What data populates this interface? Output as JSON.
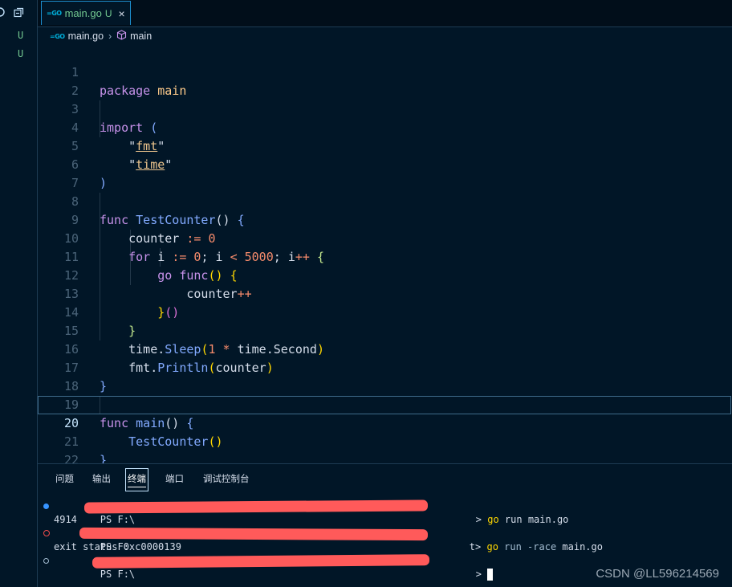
{
  "sidebar": {
    "control_icons": [
      "refresh-icon",
      "collapse-icon"
    ],
    "file_status": [
      "U",
      "U"
    ]
  },
  "tab": {
    "icon_text": "=GO",
    "filename": "main.go",
    "status": "U",
    "close": "×"
  },
  "breadcrumb": {
    "icon_text": "=GO",
    "file": "main.go",
    "separator": "›",
    "symbol": "main"
  },
  "editor": {
    "current_line": 20,
    "lines": [
      {
        "n": "1"
      },
      {
        "n": "2"
      },
      {
        "n": "3"
      },
      {
        "n": "4"
      },
      {
        "n": "5"
      },
      {
        "n": "6"
      },
      {
        "n": "7"
      },
      {
        "n": "8"
      },
      {
        "n": "9"
      },
      {
        "n": "10"
      },
      {
        "n": "11"
      },
      {
        "n": "12"
      },
      {
        "n": "13"
      },
      {
        "n": "14"
      },
      {
        "n": "15"
      },
      {
        "n": "16"
      },
      {
        "n": "17"
      },
      {
        "n": "18"
      },
      {
        "n": "19"
      },
      {
        "n": "20"
      },
      {
        "n": "21"
      },
      {
        "n": "22"
      }
    ],
    "code": {
      "l1_kw": "package",
      "l1_name": "main",
      "l3_kw": "import",
      "l3_paren": "(",
      "l4_q1": "\"",
      "l4_pkg": "fmt",
      "l4_q2": "\"",
      "l5_q1": "\"",
      "l5_pkg": "time",
      "l5_q2": "\"",
      "l6_paren": ")",
      "l8_kw": "func",
      "l8_name": "TestCounter",
      "l8_parens": "()",
      "l8_brace": "{",
      "l9_var": "counter",
      "l9_op": ":=",
      "l9_num": "0",
      "l10_for": "for",
      "l10_i": "i",
      "l10_op1": ":=",
      "l10_n0": "0",
      "l10_semi1": ";",
      "l10_i2": "i",
      "l10_lt": "<",
      "l10_n5000": "5000",
      "l10_semi2": ";",
      "l10_i3": "i",
      "l10_inc": "++",
      "l10_brace": "{",
      "l11_go": "go",
      "l11_func": "func",
      "l11_parens": "()",
      "l11_brace": "{",
      "l12_var": "counter",
      "l12_inc": "++",
      "l13_close": "}",
      "l13_call": "()",
      "l14_brace": "}",
      "l15_pkg": "time",
      "l15_dot": ".",
      "l15_fn": "Sleep",
      "l15_open": "(",
      "l15_num": "1",
      "l15_mul": "*",
      "l15_pkg2": "time",
      "l15_dot2": ".",
      "l15_const": "Second",
      "l15_close": ")",
      "l16_pkg": "fmt",
      "l16_dot": ".",
      "l16_fn": "Println",
      "l16_open": "(",
      "l16_arg": "counter",
      "l16_close": ")",
      "l17_brace": "}",
      "l19_kw": "func",
      "l19_name": "main",
      "l19_parens": "()",
      "l19_brace": "{",
      "l20_call": "TestCounter",
      "l20_parens": "()",
      "l21_brace": "}"
    }
  },
  "panel": {
    "tabs": [
      "问题",
      "输出",
      "终端",
      "端口",
      "调试控制台"
    ],
    "active_tab": "终端"
  },
  "terminal": {
    "lines": [
      {
        "prefix": "PS F:\\",
        "suffix": "> ",
        "cmd": "go",
        "args": " run main.go",
        "flag": ""
      },
      {
        "output": "4914"
      },
      {
        "prefix": "PS F:",
        "suffix": "t> ",
        "cmd": "go",
        "args": " main.go",
        "flag": " run -race"
      },
      {
        "output": "exit status 0xc0000139"
      },
      {
        "prefix": "PS F:\\",
        "suffix": "> ",
        "cmd": "",
        "args": "",
        "flag": ""
      }
    ],
    "redaction_color": "#ff5a5a"
  },
  "watermark": "CSDN @LL596214569",
  "colors": {
    "background": "#011627",
    "keyword": "#c792ea",
    "function": "#82aaff",
    "string": "#ecc48d",
    "number": "#f78c6c",
    "tab_modified": "#73c991"
  }
}
